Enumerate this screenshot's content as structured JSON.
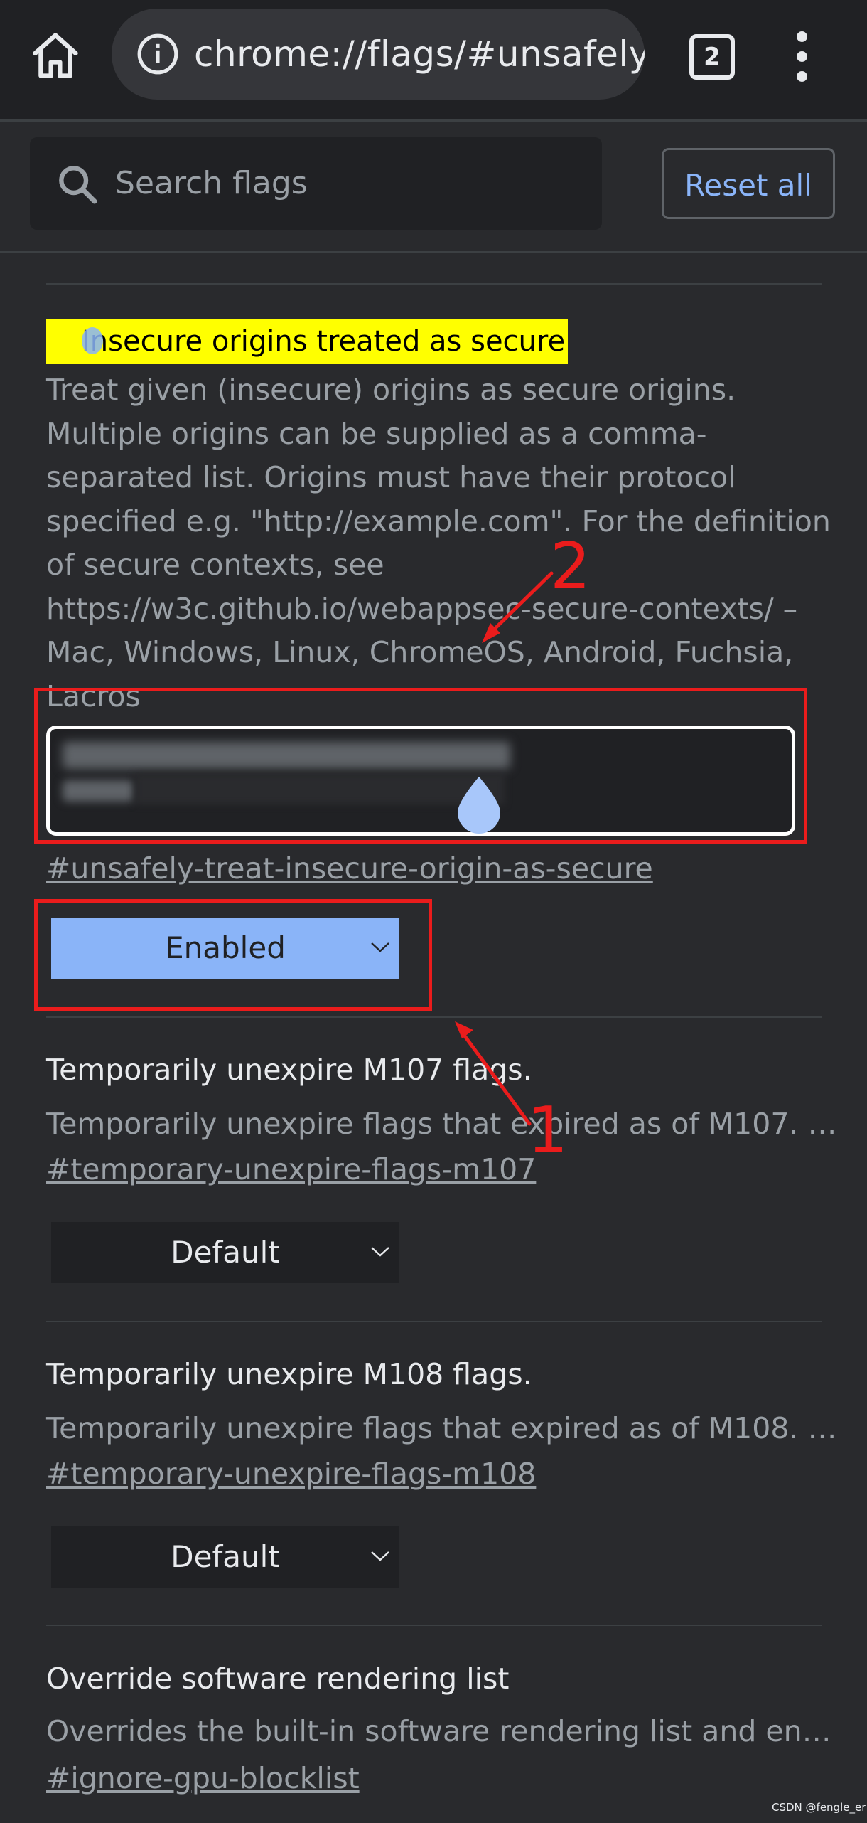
{
  "toolbar": {
    "url": "chrome://flags/#unsafely-",
    "tab_count": "2"
  },
  "search": {
    "placeholder": "Search flags",
    "reset_label": "Reset all"
  },
  "flags": [
    {
      "title": "Insecure origins treated as secure",
      "description_lines": [
        "Treat given (insecure) origins as secure origins.",
        "Multiple origins can be supplied as a comma-",
        "separated list. Origins must have their protocol",
        "specified e.g. \"http://example.com\". For the definition",
        "of secure contexts, see",
        "https://w3c.github.io/webappsec-secure-contexts/ –",
        "Mac, Windows, Linux, ChromeOS, Android, Fuchsia,",
        "Lacros"
      ],
      "link": "#unsafely-treat-insecure-origin-as-secure",
      "state": "Enabled"
    },
    {
      "title": "Temporarily unexpire M107 flags.",
      "description": "Temporarily unexpire flags that expired as of M107. …",
      "link": "#temporary-unexpire-flags-m107",
      "state": "Default"
    },
    {
      "title": "Temporarily unexpire M108 flags.",
      "description": "Temporarily unexpire flags that expired as of M108. …",
      "link": "#temporary-unexpire-flags-m108",
      "state": "Default"
    },
    {
      "title": "Override software rendering list",
      "description": "Overrides the built-in software rendering list and en…",
      "link": "#ignore-gpu-blocklist"
    }
  ],
  "annotations": {
    "label_1": "1",
    "label_2": "2",
    "color": "#ea1c1c"
  },
  "watermark": "CSDN @fengle_er",
  "icons": [
    "home-icon",
    "info-icon",
    "tab-switcher-icon",
    "more-menu-icon",
    "search-icon",
    "chevron-down-icon",
    "touch-handle-icon"
  ]
}
